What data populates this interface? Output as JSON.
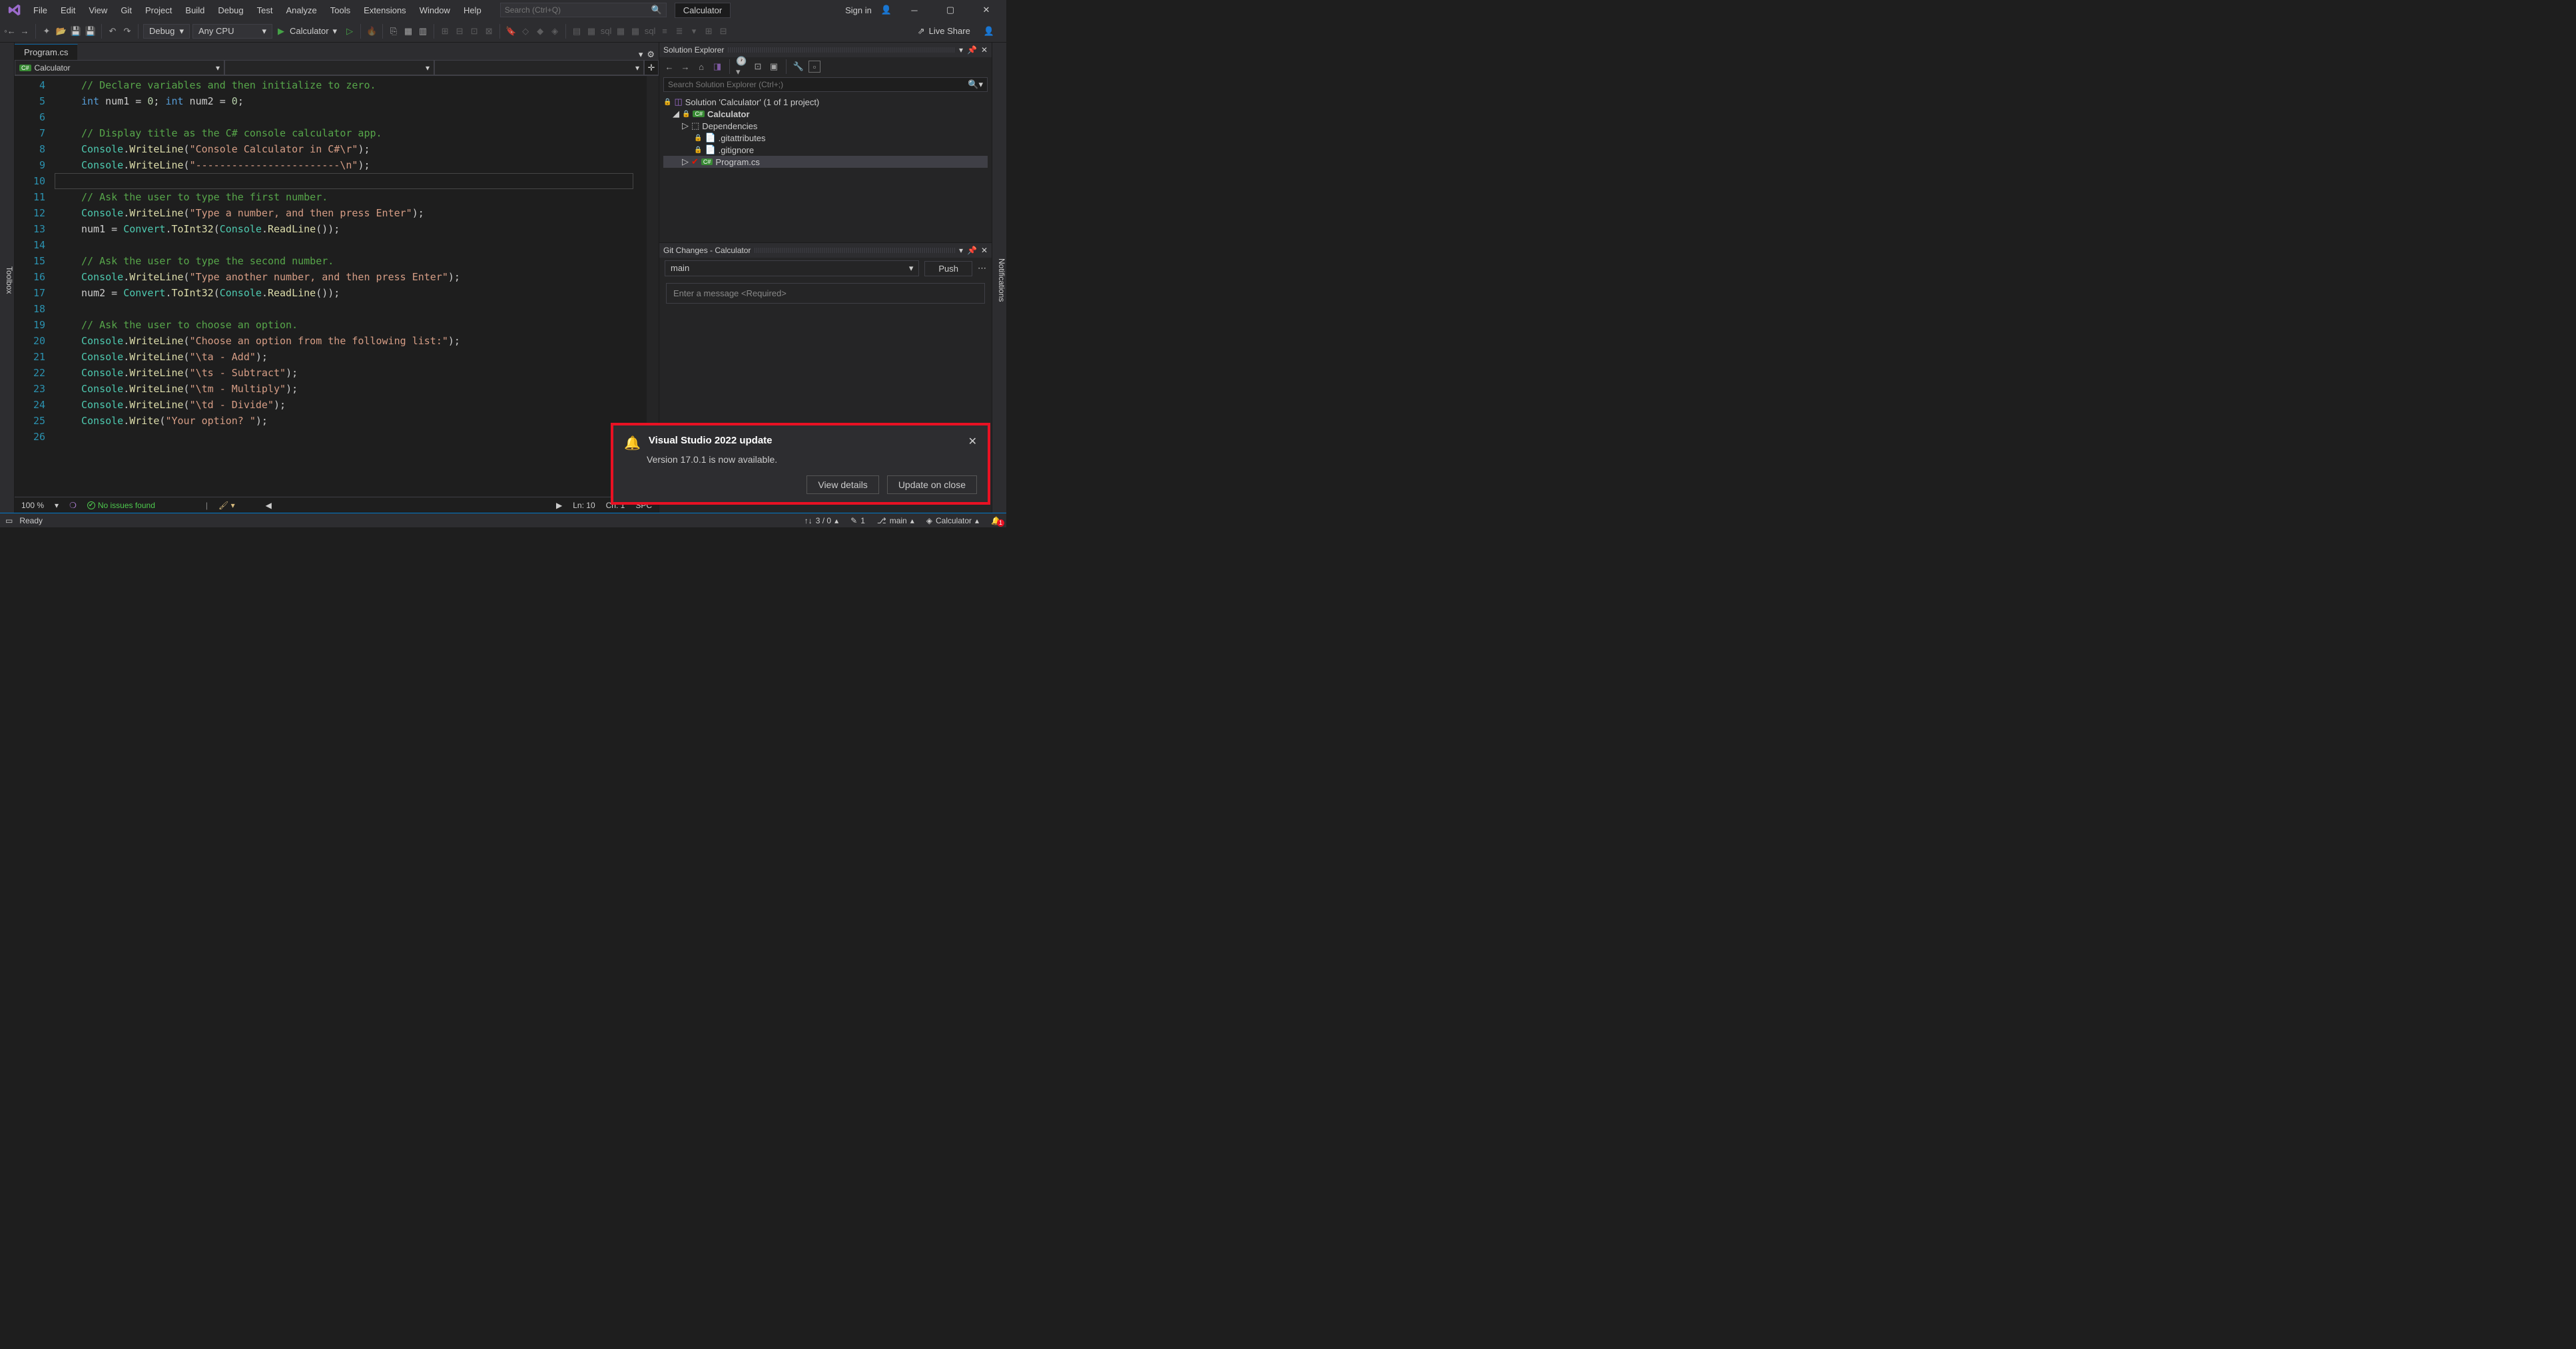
{
  "menus": [
    "File",
    "Edit",
    "View",
    "Git",
    "Project",
    "Build",
    "Debug",
    "Test",
    "Analyze",
    "Tools",
    "Extensions",
    "Window",
    "Help"
  ],
  "searchPlaceholder": "Search (Ctrl+Q)",
  "appTitle": "Calculator",
  "signIn": "Sign in",
  "toolbar": {
    "config": "Debug",
    "platform": "Any CPU",
    "startTarget": "Calculator",
    "liveShare": "Live Share"
  },
  "leftRail": "Toolbox",
  "rightRail": "Notifications",
  "docTab": "Program.cs",
  "navCombo1": "Calculator",
  "code": {
    "startLine": 4,
    "endLine": 26,
    "caretLine": 10,
    "lines": [
      {
        "n": 4,
        "t": "comment",
        "text": "// Declare variables and then initialize to zero."
      },
      {
        "n": 5,
        "t": "decl",
        "raw": "int num1 = 0; int num2 = 0;"
      },
      {
        "n": 6,
        "t": "blank"
      },
      {
        "n": 7,
        "t": "comment",
        "text": "// Display title as the C# console calculator app."
      },
      {
        "n": 8,
        "t": "call",
        "obj": "Console",
        "m": "WriteLine",
        "arg": "\"Console Calculator in C#\\r\""
      },
      {
        "n": 9,
        "t": "call",
        "obj": "Console",
        "m": "WriteLine",
        "arg": "\"------------------------\\n\""
      },
      {
        "n": 10,
        "t": "blank"
      },
      {
        "n": 11,
        "t": "comment",
        "text": "// Ask the user to type the first number."
      },
      {
        "n": 12,
        "t": "call",
        "obj": "Console",
        "m": "WriteLine",
        "arg": "\"Type a number, and then press Enter\""
      },
      {
        "n": 13,
        "t": "assign",
        "raw": "num1 = Convert.ToInt32(Console.ReadLine());"
      },
      {
        "n": 14,
        "t": "blank"
      },
      {
        "n": 15,
        "t": "comment",
        "text": "// Ask the user to type the second number."
      },
      {
        "n": 16,
        "t": "call",
        "obj": "Console",
        "m": "WriteLine",
        "arg": "\"Type another number, and then press Enter\""
      },
      {
        "n": 17,
        "t": "assign",
        "raw": "num2 = Convert.ToInt32(Console.ReadLine());"
      },
      {
        "n": 18,
        "t": "blank"
      },
      {
        "n": 19,
        "t": "comment",
        "text": "// Ask the user to choose an option."
      },
      {
        "n": 20,
        "t": "call",
        "obj": "Console",
        "m": "WriteLine",
        "arg": "\"Choose an option from the following list:\""
      },
      {
        "n": 21,
        "t": "call",
        "obj": "Console",
        "m": "WriteLine",
        "arg": "\"\\ta - Add\""
      },
      {
        "n": 22,
        "t": "call",
        "obj": "Console",
        "m": "WriteLine",
        "arg": "\"\\ts - Subtract\""
      },
      {
        "n": 23,
        "t": "call",
        "obj": "Console",
        "m": "WriteLine",
        "arg": "\"\\tm - Multiply\""
      },
      {
        "n": 24,
        "t": "call",
        "obj": "Console",
        "m": "WriteLine",
        "arg": "\"\\td - Divide\""
      },
      {
        "n": 25,
        "t": "call",
        "obj": "Console",
        "m": "Write",
        "arg": "\"Your option? \""
      },
      {
        "n": 26,
        "t": "blank"
      }
    ]
  },
  "editorStatus": {
    "zoom": "100 %",
    "issues": "No issues found",
    "ln": "Ln: 10",
    "ch": "Ch: 1",
    "spc": "SPC"
  },
  "solutionExplorer": {
    "title": "Solution Explorer",
    "searchPlaceholder": "Search Solution Explorer (Ctrl+;)",
    "solution": "Solution 'Calculator' (1 of 1 project)",
    "project": "Calculator",
    "deps": "Dependencies",
    "files": [
      ".gitattributes",
      ".gitignore",
      "Program.cs"
    ]
  },
  "gitChanges": {
    "title": "Git Changes - Calculator",
    "branch": "main",
    "push": "Push",
    "commitPlaceholder": "Enter a message <Required>"
  },
  "notification": {
    "title": "Visual Studio 2022 update",
    "body": "Version 17.0.1 is now available.",
    "viewDetails": "View details",
    "updateOnClose": "Update on close"
  },
  "statusbar": {
    "ready": "Ready",
    "upDown": "3 / 0",
    "pencil": "1",
    "branch": "main",
    "repo": "Calculator",
    "bell": "1"
  }
}
